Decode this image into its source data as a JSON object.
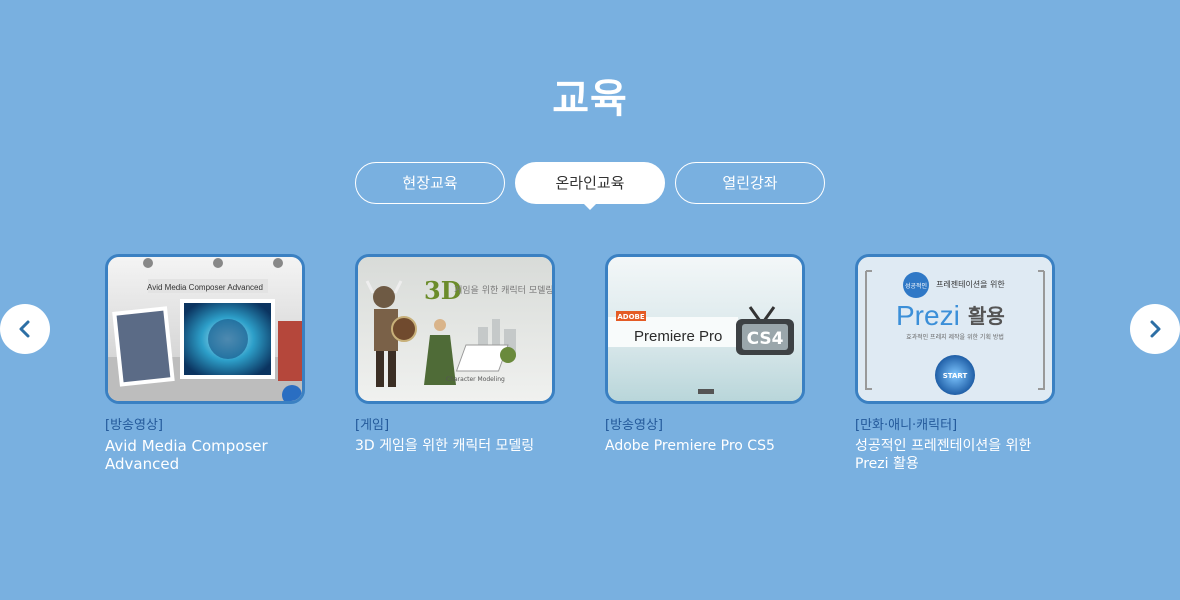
{
  "page": {
    "title": "교육"
  },
  "tabs": [
    {
      "label": "현장교육",
      "active": false
    },
    {
      "label": "온라인교육",
      "active": true
    },
    {
      "label": "열린강좌",
      "active": false
    }
  ],
  "nav": {
    "prev_icon": "chevron-left-icon",
    "next_icon": "chevron-right-icon"
  },
  "courses": [
    {
      "category": "[방송영상]",
      "title": "Avid Media Composer Advanced",
      "thumb_text": "Avid Media Composer Advanced"
    },
    {
      "category": "[게임]",
      "title": "3D 게임을 위한 캐릭터 모델링",
      "thumb_text": "3D",
      "thumb_sub": "게임을 위한 캐릭터 모델링",
      "thumb_caption": "Character Modeling"
    },
    {
      "category": "[방송영상]",
      "title": "Adobe Premiere Pro CS5",
      "thumb_text": "Premiere Pro",
      "thumb_badge": "CS4",
      "thumb_brand": "ADOBE"
    },
    {
      "category": "[만화·애니·캐릭터]",
      "title": "성공적인 프레젠테이션을 위한 Prezi 활용",
      "thumb_text": "Prezi",
      "thumb_word": "활용",
      "thumb_head": "프레젠테이션을 위한",
      "thumb_seal": "성공적인",
      "thumb_sub": "효과적인 프레지 제작을 위한 기획 방법",
      "thumb_button": "START"
    }
  ],
  "colors": {
    "background": "#79b0e0",
    "card_border": "#3a80c2",
    "category": "#23599a",
    "arrow": "#2d6fa5"
  }
}
